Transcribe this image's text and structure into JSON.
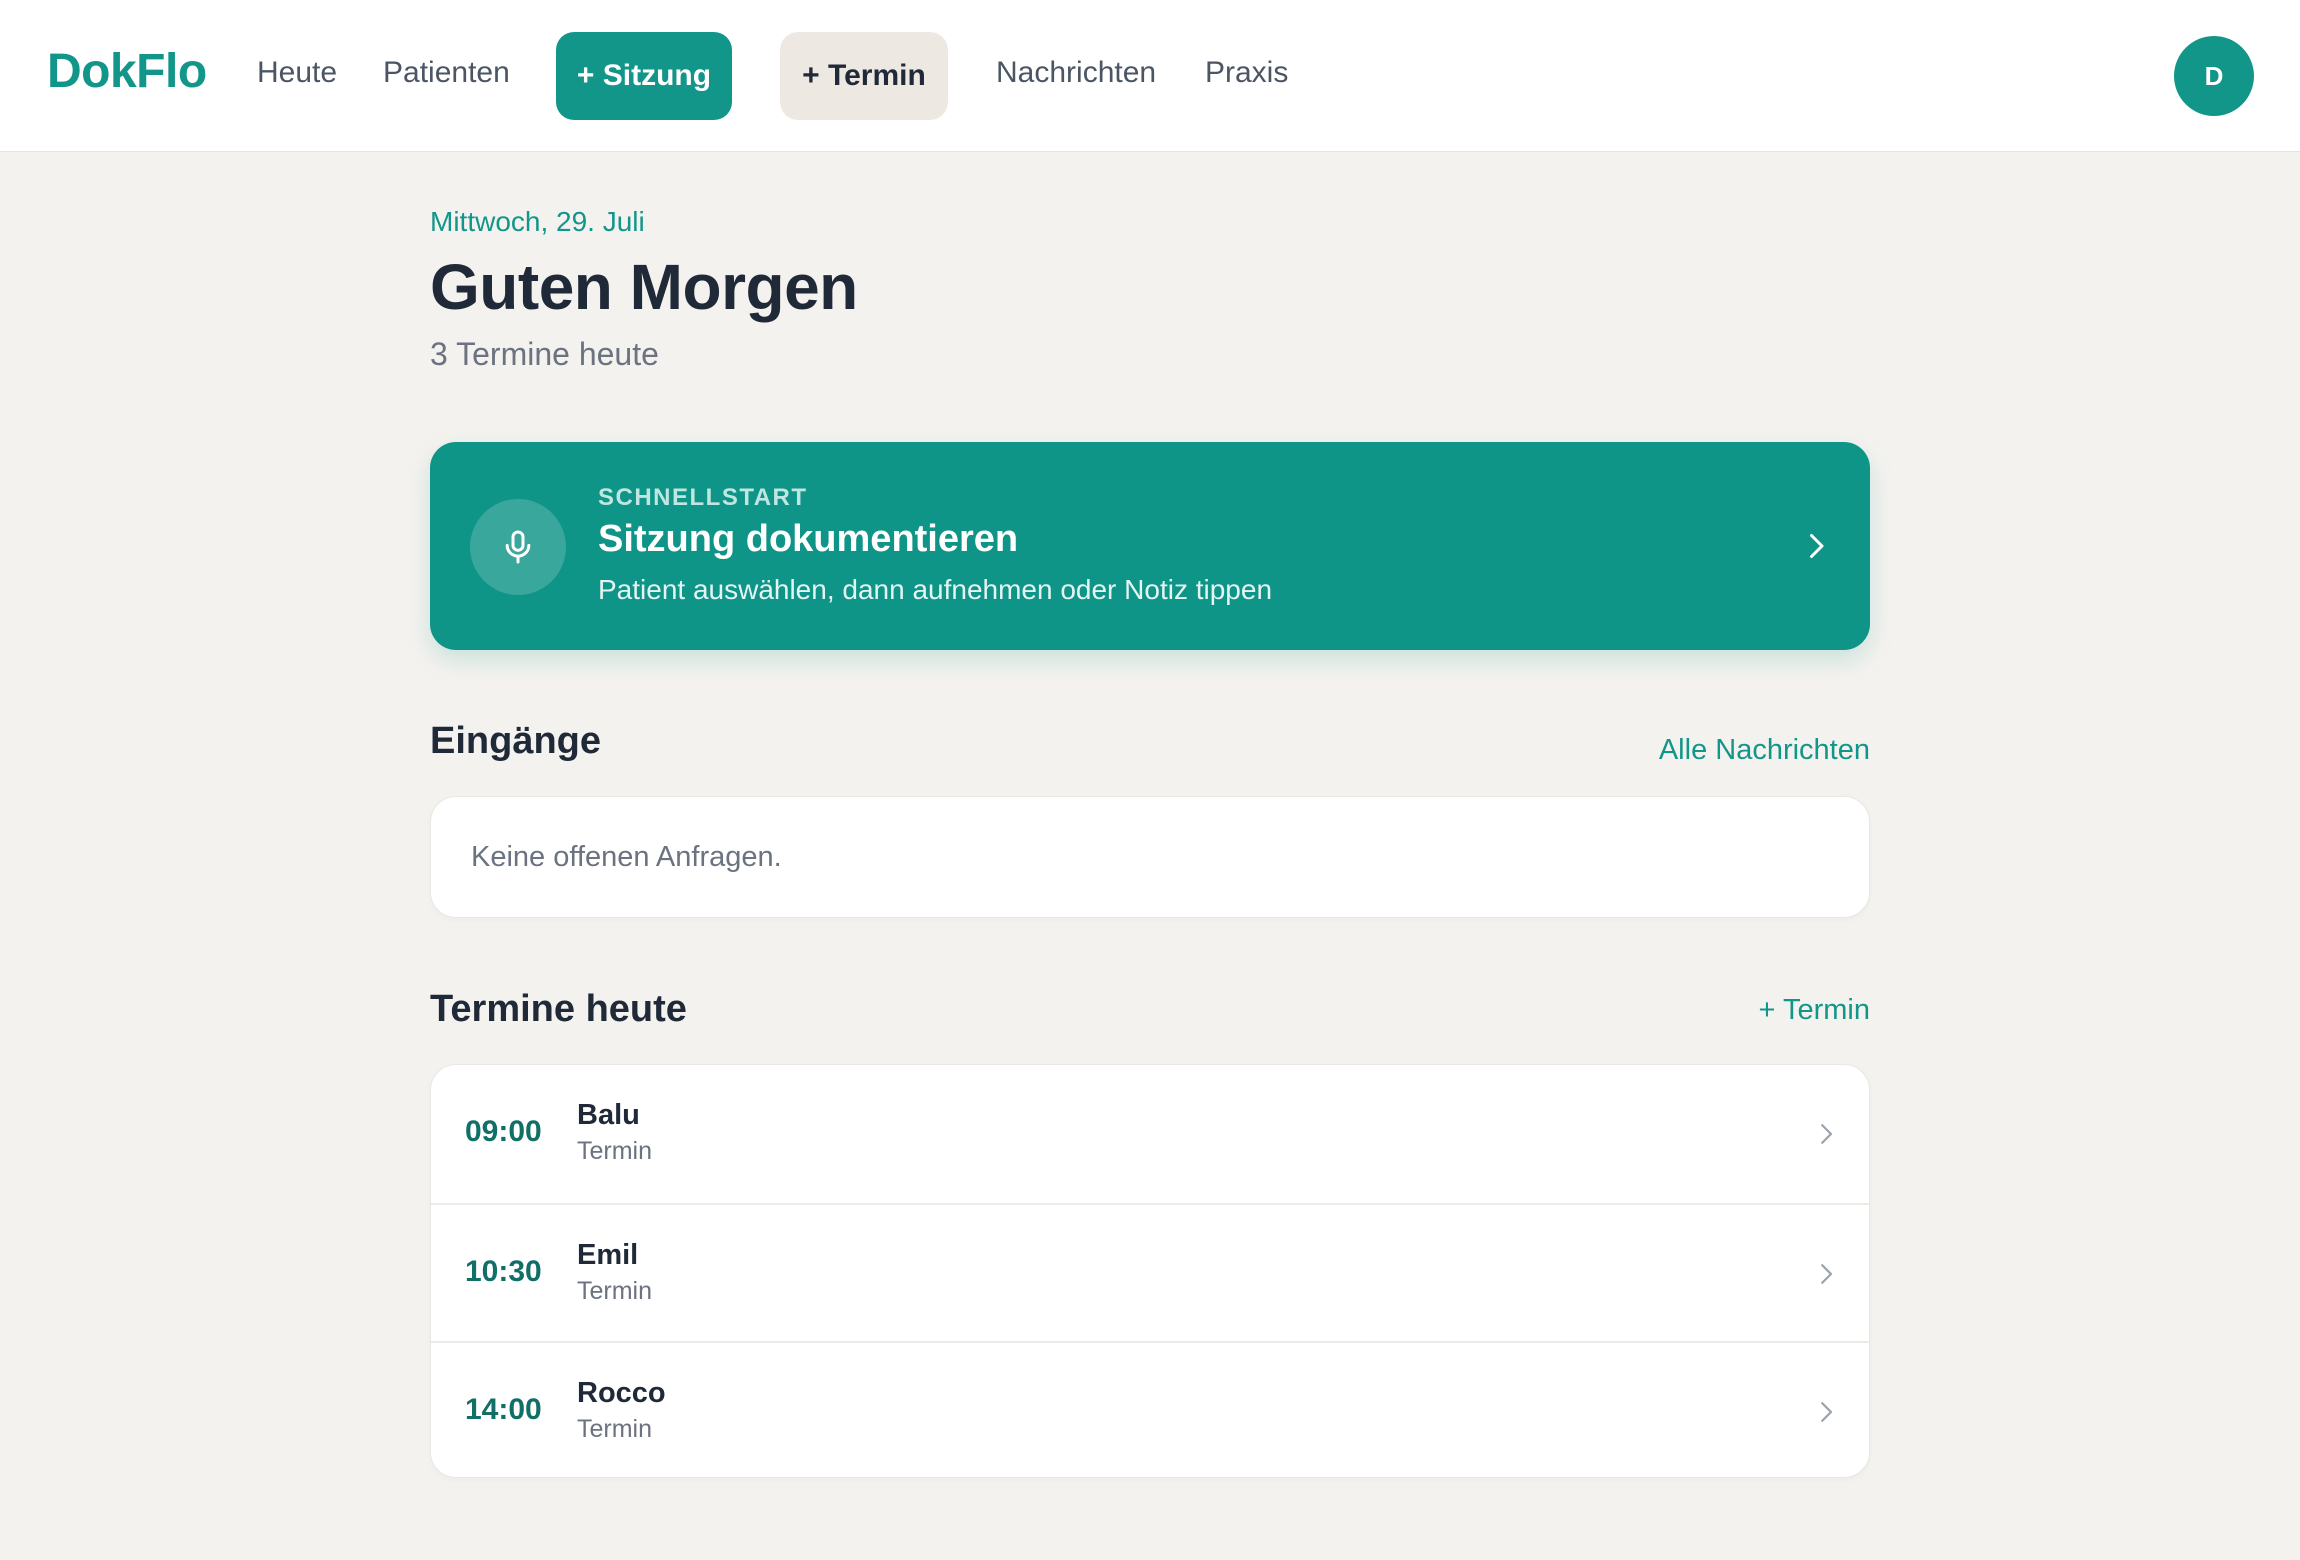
{
  "header": {
    "logo": "DokFlo",
    "nav": {
      "heute": "Heute",
      "patienten": "Patienten",
      "sitzung_button": "+ Sitzung",
      "termin_button": "+ Termin",
      "nachrichten": "Nachrichten",
      "praxis": "Praxis"
    },
    "avatar_initial": "D"
  },
  "main": {
    "date": "Mittwoch, 29. Juli",
    "greeting": "Guten Morgen",
    "subtitle": "3 Termine heute",
    "quickstart": {
      "eyebrow": "SCHNELLSTART",
      "title": "Sitzung dokumentieren",
      "description": "Patient auswählen, dann aufnehmen oder Notiz tippen",
      "icon": "microphone-icon"
    },
    "inbox": {
      "title": "Eingänge",
      "link": "Alle Nachrichten",
      "empty_text": "Keine offenen Anfragen."
    },
    "appointments": {
      "title": "Termine heute",
      "add_link": "+ Termin",
      "items": [
        {
          "time": "09:00",
          "name": "Balu",
          "type": "Termin"
        },
        {
          "time": "10:30",
          "name": "Emil",
          "type": "Termin"
        },
        {
          "time": "14:00",
          "name": "Rocco",
          "type": "Termin"
        }
      ]
    }
  },
  "colors": {
    "accent": "#13968a",
    "quickstart_bg": "#0f9488",
    "background": "#f4f2ef",
    "secondary_button": "#ede8e1"
  }
}
